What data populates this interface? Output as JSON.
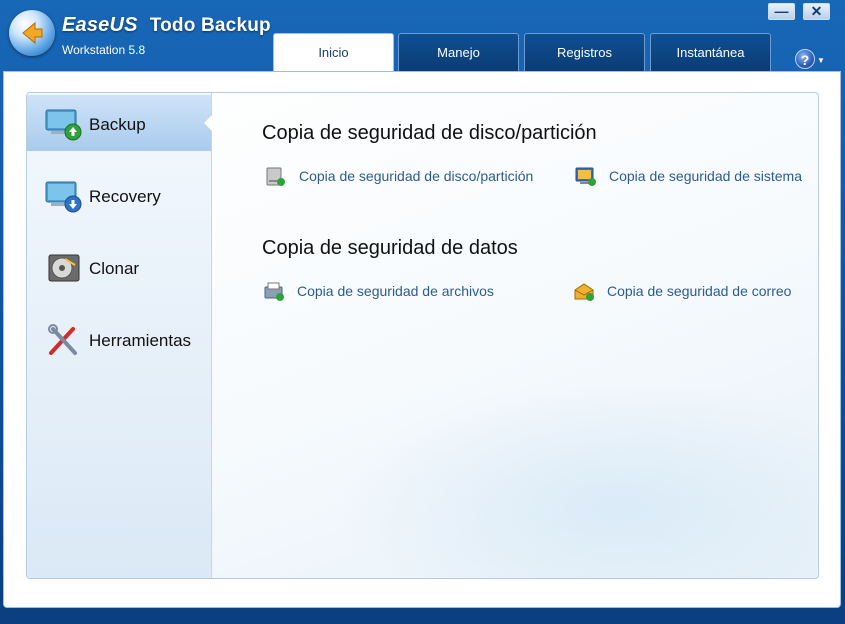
{
  "app": {
    "brand_ease": "EaseUS",
    "brand_product": "Todo Backup",
    "edition": "Workstation 5.8",
    "help_glyph": "?",
    "minimize_glyph": "—",
    "close_glyph": "✕"
  },
  "tabs": [
    {
      "label": "Inicio",
      "active": true
    },
    {
      "label": "Manejo",
      "active": false
    },
    {
      "label": "Registros",
      "active": false
    },
    {
      "label": "Instantánea",
      "active": false
    }
  ],
  "sidebar": {
    "items": [
      {
        "label": "Backup",
        "icon": "monitor-upload-icon",
        "active": true
      },
      {
        "label": "Recovery",
        "icon": "monitor-download-icon",
        "active": false
      },
      {
        "label": "Clonar",
        "icon": "disk-clone-icon",
        "active": false
      },
      {
        "label": "Herramientas",
        "icon": "tools-icon",
        "active": false
      }
    ]
  },
  "content": {
    "section1": {
      "title": "Copia de seguridad de disco/partición",
      "links": [
        {
          "label": "Copia de seguridad de disco/partición",
          "icon": "disk-backup-icon"
        },
        {
          "label": "Copia de seguridad de sistema",
          "icon": "system-backup-icon"
        }
      ]
    },
    "section2": {
      "title": "Copia de seguridad de datos",
      "links": [
        {
          "label": "Copia de seguridad de archivos",
          "icon": "file-backup-icon"
        },
        {
          "label": "Copia de seguridad de correo",
          "icon": "mail-backup-icon"
        }
      ]
    }
  },
  "colors": {
    "titlebar": "#1868b8",
    "link": "#2b5c8e",
    "sidebar_active": "#a9cbee"
  }
}
